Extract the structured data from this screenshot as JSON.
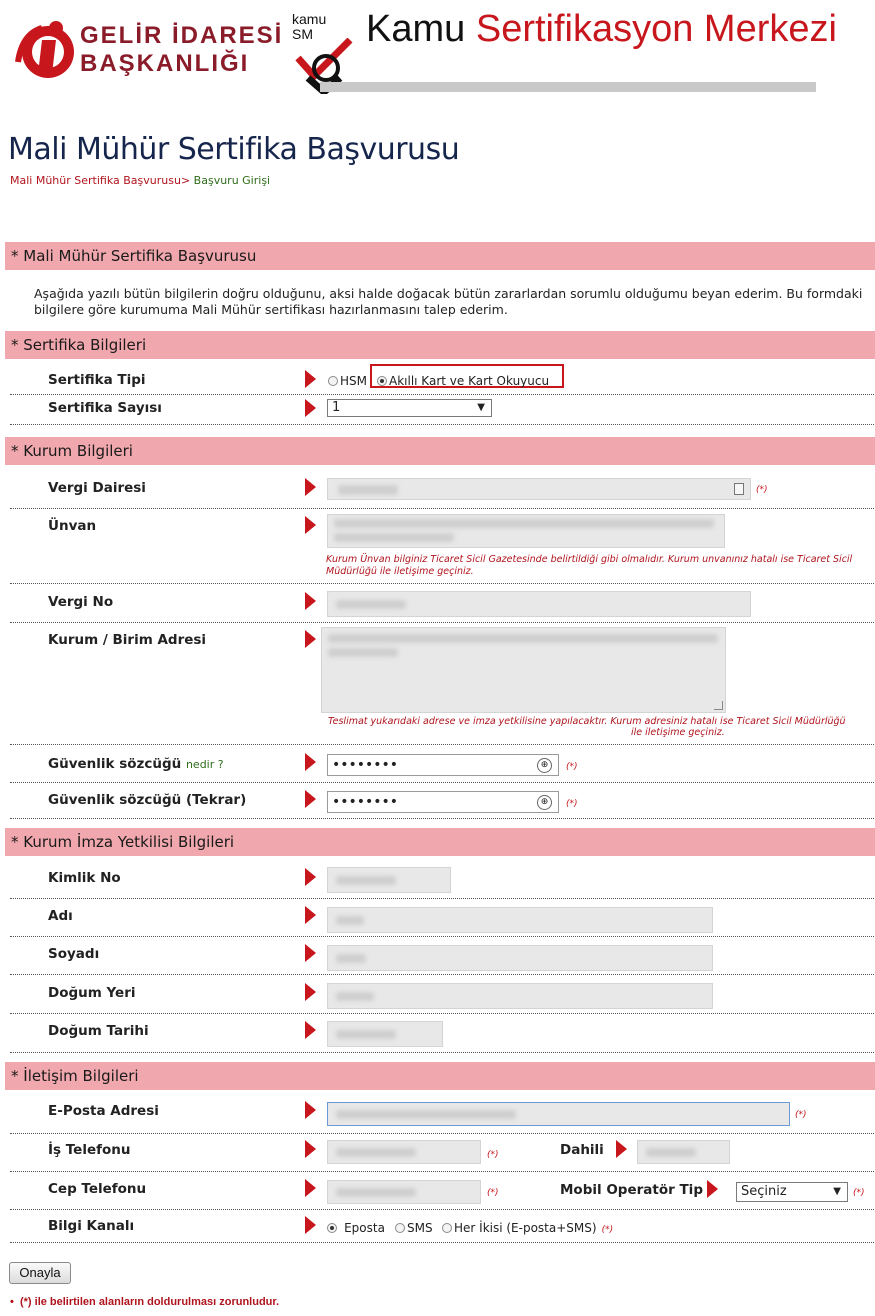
{
  "header": {
    "gib_line1": "GELİR İDARESİ",
    "gib_line2": "BAŞKANLIĞI",
    "ksm_mini_1": "kamu",
    "ksm_mini_2": "SM",
    "ksm_title_a": "Kamu",
    "ksm_title_b": "Sertifikasyon Merkezi"
  },
  "page": {
    "title": "Mali Mühür Sertifika Başvurusu",
    "breadcrumb_1": "Mali Mühür Sertifika Başvurusu>",
    "breadcrumb_2": "Başvuru Girişi"
  },
  "section1": {
    "title": "* Mali Mühür Sertifika Başvurusu",
    "intro": "Aşağıda yazılı bütün bilgilerin doğru olduğunu, aksi halde doğacak bütün zararlardan sorumlu olduğumu beyan ederim. Bu formdaki bilgilere göre kurumuma Mali Mühür sertifikası hazırlanmasını talep ederim."
  },
  "sertifika": {
    "title": "* Sertifika Bilgileri",
    "tip_label": "Sertifika Tipi",
    "tip_opt1": "HSM",
    "tip_opt2": "Akıllı Kart ve Kart Okuyucu",
    "sayi_label": "Sertifika Sayısı",
    "sayi_value": "1"
  },
  "kurum": {
    "title": "*  Kurum Bilgileri",
    "vergi_dairesi_label": "Vergi Dairesi",
    "unvan_label": "Ünvan",
    "unvan_note": "Kurum Ünvan bilginiz Ticaret Sicil Gazetesinde belirtildiği gibi olmalıdır.   Kurum unvanınız hatalı ise Ticaret Sicil Müdürlüğü ile iletişime geçiniz.",
    "vergi_no_label": "Vergi No",
    "adres_label": "Kurum / Birim Adresi",
    "adres_note_1": "Teslimat yukarıdaki adrese ve imza yetkilisine yapılacaktır.   Kurum adresiniz hatalı ise Ticaret Sicil Müdürlüğü",
    "adres_note_2": "ile iletişime geçiniz.",
    "guv_label": "Güvenlik sözcüğü",
    "guv_nedir": "nedir ?",
    "guv_value": "••••••••",
    "guv2_label": "Güvenlik sözcüğü (Tekrar)",
    "guv2_value": "••••••••"
  },
  "imza": {
    "title": "*  Kurum İmza Yetkilisi Bilgileri",
    "kimlik_label": "Kimlik No",
    "adi_label": "Adı",
    "soyadi_label": "Soyadı",
    "dogum_yeri_label": "Doğum Yeri",
    "dogum_tarihi_label": "Doğum Tarihi"
  },
  "iletisim": {
    "title": "*  İletişim Bilgileri",
    "eposta_label": "E-Posta Adresi",
    "is_tel_label": "İş Telefonu",
    "dahili_label": "Dahili",
    "cep_label": "Cep Telefonu",
    "mobil_label": "Mobil Operatör Tip",
    "mobil_value": "Seçiniz",
    "kanal_label": "Bilgi Kanalı",
    "kanal_opt1": "Eposta",
    "kanal_opt2": "SMS",
    "kanal_opt3": "Her İkisi (E-posta+SMS)"
  },
  "common": {
    "required_mark": "(*)"
  },
  "footer": {
    "submit_label": "Onayla",
    "footnote": "(*) ile belirtilen alanların doldurulması zorunludur."
  }
}
